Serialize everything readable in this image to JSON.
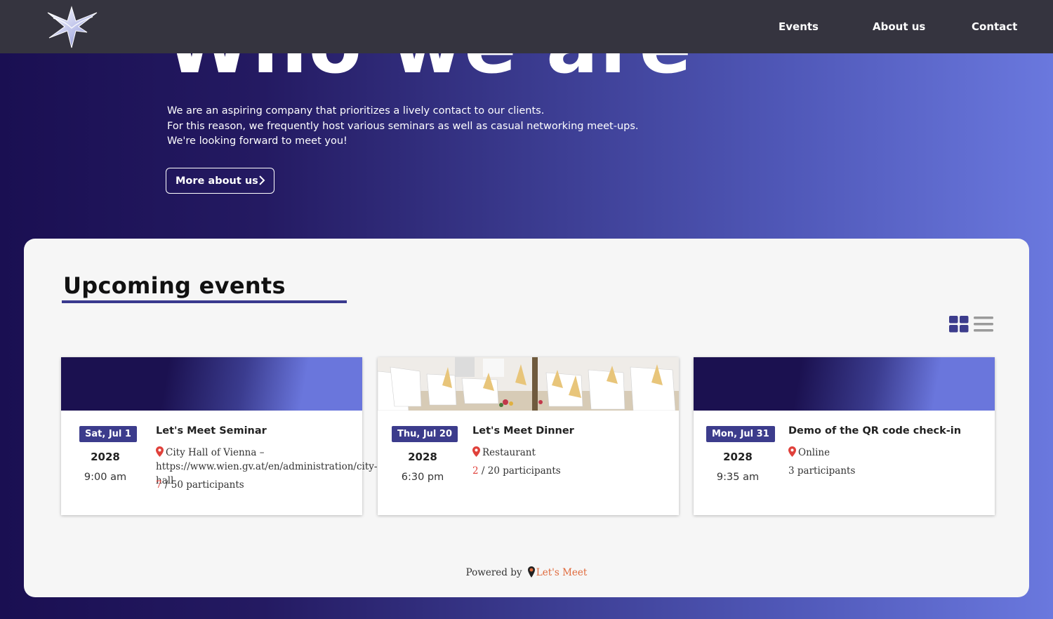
{
  "header": {
    "nav": [
      {
        "label": "Events"
      },
      {
        "label": "About us"
      },
      {
        "label": "Contact"
      }
    ]
  },
  "hero": {
    "title": "Who we are",
    "lines": [
      "We are an aspiring company that prioritizes a lively contact to our clients.",
      "For this reason, we frequently host various seminars as well as casual networking meet-ups.",
      "We're looking forward to meet you!"
    ],
    "button_label": "More about us"
  },
  "events_section": {
    "title": "Upcoming events",
    "view_modes": [
      "grid-icon",
      "list-icon"
    ],
    "events": [
      {
        "date": "Sat, Jul 1",
        "year": "2028",
        "time": "9:00 am",
        "title": "Let's Meet Seminar",
        "location": "City Hall of Vienna – https://www.wien.gv.at/en/administration/city-hall",
        "registered": "7",
        "capacity": " / 50 participants"
      },
      {
        "date": "Thu, Jul 20",
        "year": "2028",
        "time": "6:30 pm",
        "title": "Let's Meet Dinner",
        "location": "Restaurant",
        "registered": "2",
        "capacity": " / 20 participants"
      },
      {
        "date": "Mon, Jul 31",
        "year": "2028",
        "time": "9:35 am",
        "title": "Demo of the QR code check-in",
        "location": "Online",
        "participants": "3 participants"
      }
    ]
  },
  "footer": {
    "powered_by": "Powered by",
    "brand": "Let's Meet"
  },
  "colors": {
    "accent": "#3c3c8c",
    "highlight": "#e0413b",
    "brand": "#e06a3c",
    "topbar": "#35343f"
  }
}
